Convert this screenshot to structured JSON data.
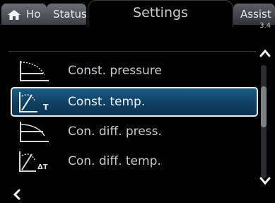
{
  "tabs": {
    "home_label": "Ho",
    "status_label": "Status",
    "settings_label": "Settings",
    "assist_label": "Assist",
    "assist_version": "3.4"
  },
  "list": {
    "items": [
      {
        "label": "Const. pressure",
        "icon": "const-pressure-icon"
      },
      {
        "label": "Const. temp.",
        "icon": "const-temp-icon",
        "selected": true
      },
      {
        "label": "Con. diff. press.",
        "icon": "diff-press-icon"
      },
      {
        "label": "Con. diff. temp.",
        "icon": "diff-temp-icon"
      }
    ]
  },
  "icon_text": {
    "temp_symbol": "T",
    "delta_temp_symbol": "ΔT"
  },
  "colors": {
    "selection_fill": "#1a5478",
    "selection_border": "#e9ecef",
    "tab_fill": "#5b5f64",
    "background": "#000000"
  }
}
